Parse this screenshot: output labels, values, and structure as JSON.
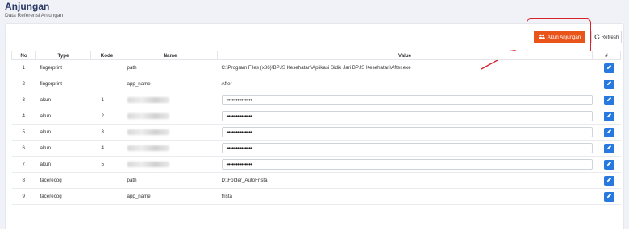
{
  "header": {
    "title": "Anjungan",
    "subtitle": "Data Referensi Anjungan"
  },
  "toolbar": {
    "akun_label": "Akun Anjungan",
    "refresh_label": "Refresh"
  },
  "table": {
    "columns": [
      "No",
      "Type",
      "Kode",
      "Name",
      "Value",
      "#"
    ],
    "rows": [
      {
        "no": "1",
        "type": "fingerprint",
        "kode": "",
        "name": "path",
        "value": "C:\\Program Files (x86)\\BPJS Kesehatan\\Aplikasi Sidik Jari BPJS Kesehatan\\After.exe",
        "masked": false
      },
      {
        "no": "2",
        "type": "fingerprint",
        "kode": "",
        "name": "app_name",
        "value": "After",
        "masked": false
      },
      {
        "no": "3",
        "type": "akun",
        "kode": "1",
        "name": "",
        "value": "••••••••••••••",
        "masked": true
      },
      {
        "no": "4",
        "type": "akun",
        "kode": "2",
        "name": "",
        "value": "••••••••••••••",
        "masked": true
      },
      {
        "no": "5",
        "type": "akun",
        "kode": "3",
        "name": "",
        "value": "••••••••••••••",
        "masked": true
      },
      {
        "no": "6",
        "type": "akun",
        "kode": "4",
        "name": "",
        "value": "••••••••••••••",
        "masked": true
      },
      {
        "no": "7",
        "type": "akun",
        "kode": "5",
        "name": "",
        "value": "••••••••••••••",
        "masked": true
      },
      {
        "no": "8",
        "type": "facerecog",
        "kode": "",
        "name": "path",
        "value": "D:\\Folder_AutoFrista",
        "masked": false
      },
      {
        "no": "9",
        "type": "facerecog",
        "kode": "",
        "name": "app_name",
        "value": "frista",
        "masked": false
      }
    ]
  },
  "icons": {
    "akun": "users-icon",
    "refresh": "refresh-icon",
    "edit": "pencil-icon",
    "arrow": "annotation-arrow"
  },
  "colors": {
    "primary": "#e8541a",
    "edit": "#2779e0",
    "highlight": "#d9232a",
    "title": "#2b3a67"
  }
}
